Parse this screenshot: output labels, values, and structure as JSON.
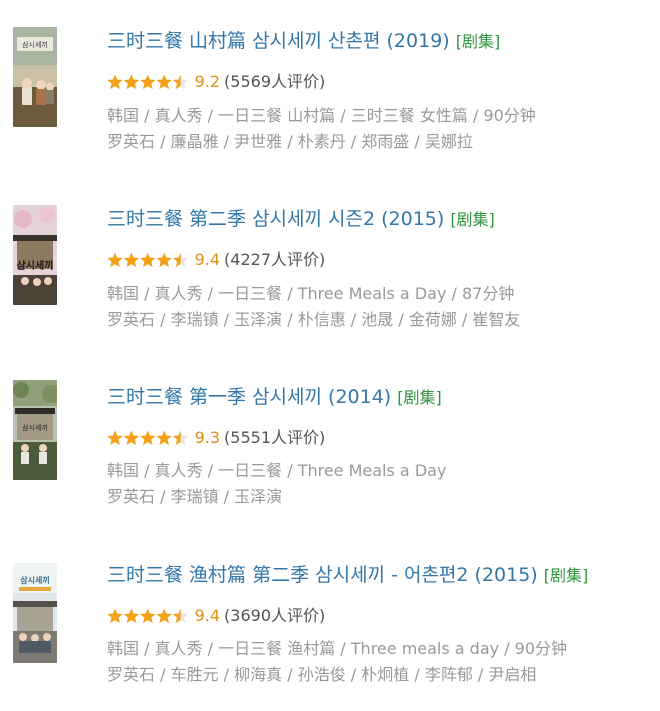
{
  "results": [
    {
      "title": "三时三餐 山村篇 삼시세끼 산촌편 (2019)",
      "tag": "[剧集]",
      "score": "9.2",
      "votes": "(5569人评价)",
      "stars": 4.5,
      "info": "韩国 / 真人秀 / 一日三餐 山村篇 / 三时三餐 女性篇 / 90分钟",
      "cast": "罗英石 / 廉晶雅 / 尹世雅 / 朴素丹 / 郑雨盛 / 吴娜拉",
      "poster_text": "삼시세끼",
      "poster_colors": {
        "sky": "#c9c0a6",
        "ground": "#6b5a3c",
        "accent": "#a8734a"
      }
    },
    {
      "title": "三时三餐 第二季 삼시세끼 시즌2 (2015)",
      "tag": "[剧集]",
      "score": "9.4",
      "votes": "(4227人评价)",
      "stars": 4.5,
      "info": "韩国 / 真人秀 / 一日三餐 / Three Meals a Day / 87分钟",
      "cast": "罗英石 / 李瑞镇 / 玉泽演 / 朴信惠 / 池晟 / 金荷娜 / 崔智友",
      "poster_text": "삼시세끼",
      "poster_colors": {
        "sky": "#e6d3d8",
        "ground": "#4b4238",
        "accent": "#2a241f"
      }
    },
    {
      "title": "三时三餐 第一季 삼시세끼 (2014)",
      "tag": "[剧集]",
      "score": "9.3",
      "votes": "(5551人评价)",
      "stars": 4.5,
      "info": "韩国 / 真人秀 / 一日三餐 / Three Meals a Day",
      "cast": "罗英石 / 李瑞镇 / 玉泽演",
      "poster_text": "삼시세끼",
      "poster_colors": {
        "sky": "#b9c2b0",
        "ground": "#4a5a3a",
        "accent": "#e8e6de"
      }
    },
    {
      "title": "三时三餐 渔村篇 第二季 삼시세끼 - 어촌편2 (2015)",
      "tag": "[剧集]",
      "score": "9.4",
      "votes": "(3690人评价)",
      "stars": 4.5,
      "info": "韩国 / 真人秀 / 一日三餐 渔村篇 / Three meals a day / 90分钟",
      "cast": "罗英石 / 车胜元 / 柳海真 / 孙浩俊 / 朴炯植 / 李阵郁 / 尹启相",
      "poster_text": "삼시세끼",
      "poster_colors": {
        "sky": "#dfe7ea",
        "ground": "#7c7a72",
        "accent": "#3f6f8a"
      }
    }
  ],
  "colors": {
    "title": "#3377aa",
    "tag": "#2e963d",
    "score": "#e09015",
    "star": "#f4a11a",
    "star_empty": "#e6e6e6",
    "meta": "#999999"
  },
  "icons": {
    "star": "star-icon"
  }
}
